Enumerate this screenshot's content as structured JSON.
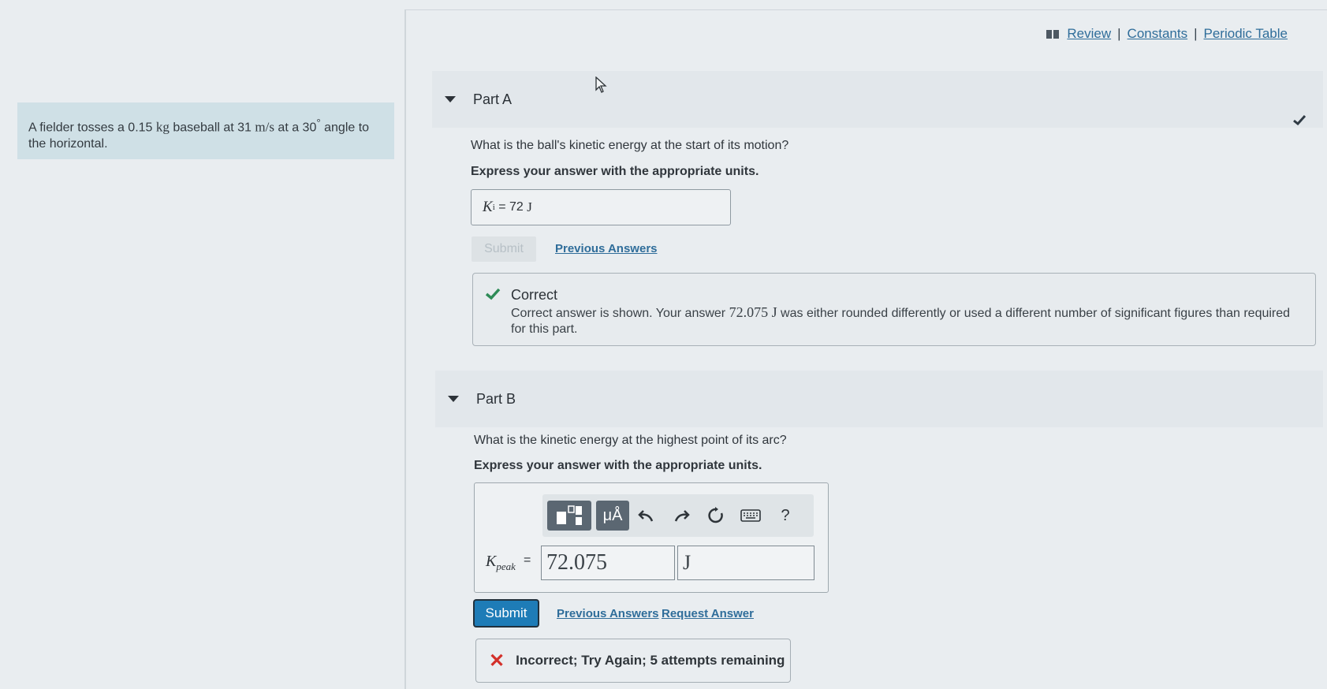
{
  "top_links": {
    "review": "Review",
    "constants": "Constants",
    "periodic_table": "Periodic Table",
    "separator": "|"
  },
  "problem": {
    "t1": "A fielder tosses a 0.15 ",
    "kg": "kg",
    "t2": " baseball at 31 ",
    "ms": "m/s",
    "t3": " at a 30",
    "deg": "°",
    "t4": " angle to the horizontal."
  },
  "part_a": {
    "title": "Part A",
    "question": "What is the ball's kinetic energy at the start of its motion?",
    "instruction": "Express your answer with the appropriate units.",
    "answer_var": "K",
    "answer_sub": "i",
    "answer_eq": " = 72 ",
    "answer_unit": "J",
    "submit_label": "Submit",
    "previous_answers": "Previous Answers",
    "feedback_title": "Correct",
    "feedback_t1": "Correct answer is shown. Your answer ",
    "feedback_value": "72.075 J",
    "feedback_t2": " was either rounded differently or used a different number of significant figures than required for this part."
  },
  "part_b": {
    "title": "Part B",
    "question": "What is the kinetic energy at the highest point of its arc?",
    "instruction": "Express your answer with the appropriate units.",
    "toolbar_units_label": "μÅ",
    "toolbar_help": "?",
    "answer_var": "K",
    "answer_sub": "peak",
    "answer_eq": "=",
    "value": "72.075",
    "unit": "J",
    "submit_label": "Submit",
    "previous_answers": "Previous Answers",
    "request_answer": "Request Answer",
    "feedback": "Incorrect; Try Again; 5 attempts remaining"
  },
  "colors": {
    "link": "#2f6d9a",
    "submit": "#1e7cb7",
    "correct": "#2e8b57",
    "incorrect": "#d3302a"
  }
}
